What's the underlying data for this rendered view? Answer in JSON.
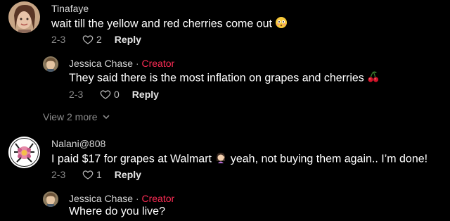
{
  "comments": [
    {
      "username": "Tinafaye",
      "text": "wait till the yellow and red cherries come out",
      "emoji": "flushed-face-emoji",
      "date": "2-3",
      "likes": "2",
      "reply_label": "Reply",
      "reply": {
        "username": "Jessica Chase",
        "separator": "·",
        "badge": "Creator",
        "text": "They said there is the most inflation on grapes and cherries",
        "emoji": "cherries-emoji",
        "date": "2-3",
        "likes": "0",
        "reply_label": "Reply"
      },
      "view_more": "View 2 more"
    },
    {
      "username": "Nalani@808",
      "text_before": "I paid $17 for grapes at Walmart",
      "emoji": "woman-facepalming-emoji",
      "text_after": "yeah, not buying them again.. I’m done!",
      "date": "2-3",
      "likes": "1",
      "reply_label": "Reply",
      "reply": {
        "username": "Jessica Chase",
        "separator": "·",
        "badge": "Creator",
        "text": "Where do you live?"
      }
    }
  ],
  "colors": {
    "background": "#000000",
    "creator_badge": "#fe2c55",
    "meta_text": "#8a8a8a"
  }
}
